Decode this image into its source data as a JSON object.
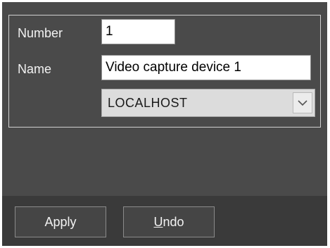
{
  "form": {
    "number_label": "Number",
    "number_value": "1",
    "name_label": "Name",
    "name_value": "Video capture device 1",
    "host_value": "LOCALHOST"
  },
  "buttons": {
    "apply_label": "Apply",
    "undo_first": "U",
    "undo_rest": "ndo"
  },
  "colors": {
    "panel": "#4a4a4a",
    "footer": "#3a3a3a",
    "text": "#f2f2f2"
  },
  "icons": {
    "combo_arrow": "chevron-down-icon"
  }
}
